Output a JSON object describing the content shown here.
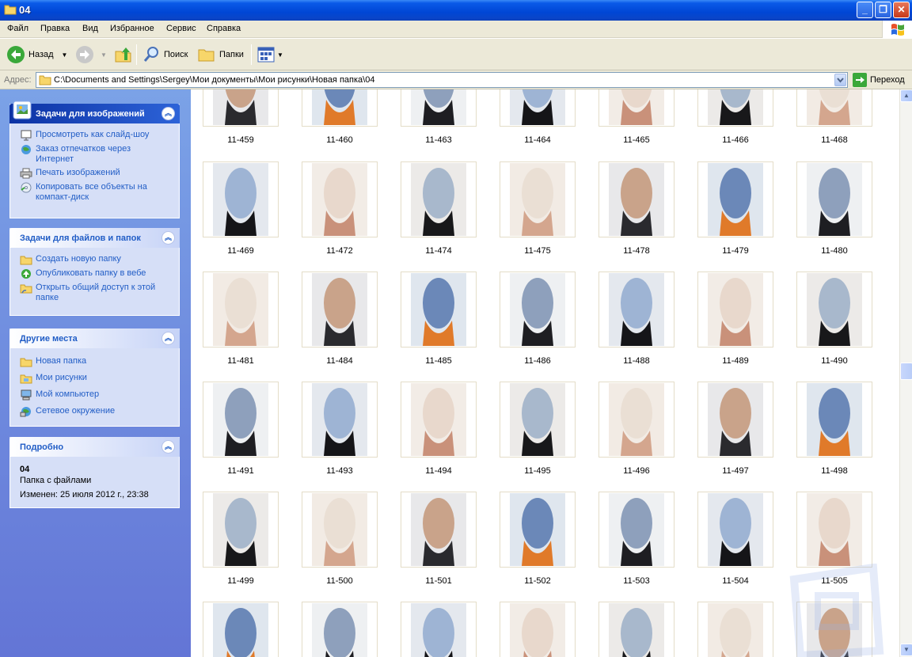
{
  "window": {
    "title": "04"
  },
  "menu": {
    "items": [
      "Файл",
      "Правка",
      "Вид",
      "Избранное",
      "Сервис",
      "Справка"
    ]
  },
  "toolbar": {
    "back_label": "Назад",
    "search_label": "Поиск",
    "folders_label": "Папки"
  },
  "address": {
    "label": "Адрес:",
    "path": "C:\\Documents and Settings\\Sergey\\Мои документы\\Мои рисунки\\Новая папка\\04",
    "go_label": "Переход"
  },
  "sidebar": {
    "image_tasks": {
      "title": "Задачи для изображений",
      "items": [
        "Просмотреть как слайд-шоу",
        "Заказ отпечатков через Интернет",
        "Печать изображений",
        "Копировать все объекты на компакт-диск"
      ]
    },
    "file_tasks": {
      "title": "Задачи для файлов и папок",
      "items": [
        "Создать новую папку",
        "Опубликовать папку в вебе",
        "Открыть общий доступ к этой папке"
      ]
    },
    "other_places": {
      "title": "Другие места",
      "items": [
        "Новая папка",
        "Мои рисунки",
        "Мой компьютер",
        "Сетевое окружение"
      ]
    },
    "details": {
      "title": "Подробно",
      "name": "04",
      "type": "Папка с файлами",
      "modified": "Изменен: 25 июля 2012 г., 23:38"
    }
  },
  "thumbnails": {
    "rows": [
      [
        "11-459",
        "11-460",
        "11-463",
        "11-464",
        "11-465",
        "11-466",
        "11-468"
      ],
      [
        "11-469",
        "11-472",
        "11-474",
        "11-475",
        "11-478",
        "11-479",
        "11-480"
      ],
      [
        "11-481",
        "11-484",
        "11-485",
        "11-486",
        "11-488",
        "11-489",
        "11-490"
      ],
      [
        "11-491",
        "11-493",
        "11-494",
        "11-495",
        "11-496",
        "11-497",
        "11-498"
      ],
      [
        "11-499",
        "11-500",
        "11-501",
        "11-502",
        "11-503",
        "11-504",
        "11-505"
      ],
      [
        "",
        "",
        "",
        "",
        "",
        "",
        ""
      ]
    ]
  },
  "colors": {
    "title_bar": "#0046d5",
    "sidebar": "#6375d6",
    "panel": "#d6dff7",
    "link": "#215dc6"
  }
}
